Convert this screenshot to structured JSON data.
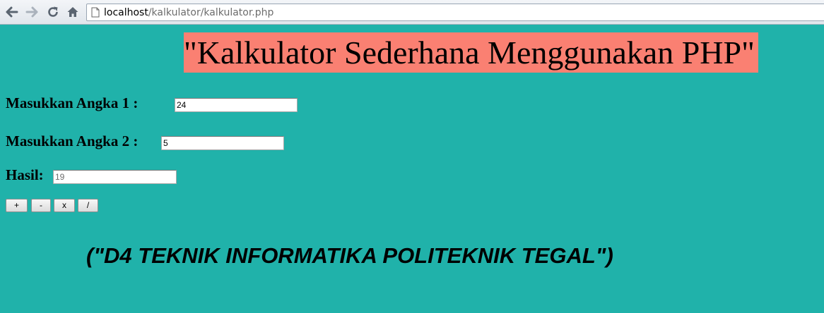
{
  "browser": {
    "url_host": "localhost",
    "url_path": "/kalkulator/kalkulator.php"
  },
  "page": {
    "title": "\"Kalkulator Sederhana Menggunakan PHP\"",
    "background_color": "#20b2aa",
    "title_background_color": "#fa8072"
  },
  "form": {
    "angka1_label": "Masukkan Angka 1 :",
    "angka1_value": "24",
    "angka2_label": "Masukkan Angka 2 :",
    "angka2_value": "5",
    "hasil_label": "Hasil:",
    "hasil_value": "19",
    "buttons": {
      "add": "+",
      "subtract": "-",
      "multiply": "x",
      "divide": "/"
    }
  },
  "footer": {
    "text": "(\"D4 TEKNIK INFORMATIKA POLITEKNIK TEGAL\")"
  }
}
